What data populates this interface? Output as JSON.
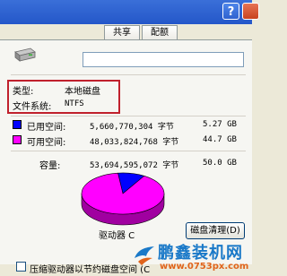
{
  "window": {
    "help_button_label": "?"
  },
  "tabs": [
    {
      "label": "共享"
    },
    {
      "label": "配额"
    }
  ],
  "general": {
    "volume_name_value": "",
    "type_label": "类型:",
    "type_value": "本地磁盘",
    "filesystem_label": "文件系统:",
    "filesystem_value": "NTFS",
    "used_label": "已用空间:",
    "used_bytes": "5,660,770,304 字节",
    "used_gb": "5.27 GB",
    "free_label": "可用空间:",
    "free_bytes": "48,033,824,768 字节",
    "free_gb": "44.7 GB",
    "capacity_label": "容量:",
    "capacity_bytes": "53,694,595,072 字节",
    "capacity_gb": "50.0 GB",
    "drive_label": "驱动器 C",
    "cleanup_button": "磁盘清理(D)",
    "compress_checkbox_label": "压缩驱动器以节约磁盘空间 (C",
    "compress_checked": false
  },
  "colors": {
    "used": "#0000ff",
    "free": "#ff00ff",
    "highlight_box": "#c0202c"
  },
  "chart_data": {
    "type": "pie",
    "title": "",
    "slices": [
      {
        "name": "已用空间",
        "value": 5660770304,
        "color": "#0000ff"
      },
      {
        "name": "可用空间",
        "value": 48033824768,
        "color": "#ff00ff"
      }
    ]
  },
  "watermark": {
    "title": "鹏鑫装机网",
    "url": "www.0753px.com"
  }
}
